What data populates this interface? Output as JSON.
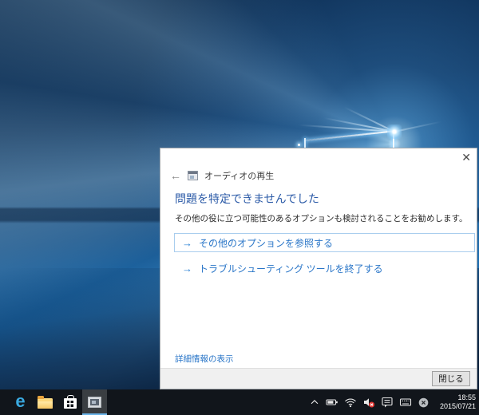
{
  "dialog": {
    "window_title": "オーディオの再生",
    "back_glyph": "←",
    "close_glyph": "✕",
    "heading": "問題を特定できませんでした",
    "description": "その他の役に立つ可能性のあるオプションも検討されることをお勧めします。",
    "options": [
      {
        "arrow": "→",
        "label": "その他のオプションを参照する"
      },
      {
        "arrow": "→",
        "label": "トラブルシューティング ツールを終了する"
      }
    ],
    "details_link": "詳細情報の表示",
    "close_button_label": "閉じる",
    "colors": {
      "heading": "#2b5aa7",
      "link": "#2a76c8",
      "focus_border": "#a9cdee"
    }
  },
  "taskbar": {
    "apps": [
      {
        "name": "microsoft-edge",
        "glyph": "e"
      },
      {
        "name": "file-explorer"
      },
      {
        "name": "windows-store"
      },
      {
        "name": "troubleshooter",
        "active": true
      }
    ],
    "tray_icons": [
      "show-hidden-chevron",
      "battery",
      "wifi",
      "volume-muted",
      "feedback",
      "touch-keyboard",
      "dismiss-circle"
    ],
    "clock": {
      "time": "18:55",
      "date": "2015/07/21"
    },
    "colors": {
      "background": "#11151b",
      "active_underline": "#6ab3e8",
      "mute_badge": "#e53935"
    }
  }
}
